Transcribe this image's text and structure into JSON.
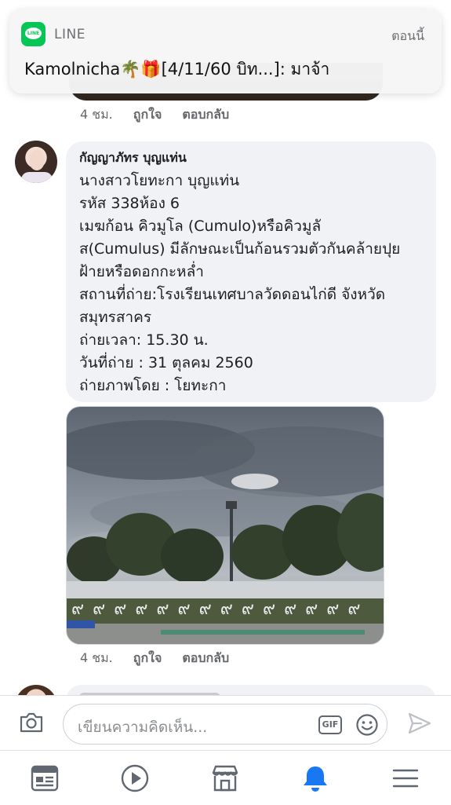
{
  "notification": {
    "app_name": "LINE",
    "icon_label": "LINE",
    "time": "ตอนนี้",
    "message": "Kamolnicha🌴🎁[4/11/60 บิท...]: มาจ้า"
  },
  "previous_comment": {
    "time": "4 ชม.",
    "like": "ถูกใจ",
    "reply": "ตอบกลับ"
  },
  "comment": {
    "author": "กัญญาภัทร บุญแท่น",
    "lines": [
      "นางสาวโยทะกา บุญแท่น",
      "รหัส 338ห้อง 6",
      "เมฆก้อน คิวมูโล (Cumulo)หรือคิวมูลั",
      "ส(Cumulus) มีลักษณะเป็นก้อนรวมตัวกันคล้ายปุย",
      "ฝ้ายหรือดอกกะหล่ำ",
      "สถานที่ถ่าย:โรงเรียนเทศบาลวัดดอนไก่ดี จังหวัด",
      "สมุทรสาคร",
      "ถ่ายเวลา: 15.30 น.",
      "วันที่ถ่าย : 31 ตุลคม 2560",
      "ถ่ายภาพโดย : โยทะกา"
    ],
    "photo_caption_glyphs": "๙ ๙ ๙ ๙ ๙ ๙ ๙ ๙ ๙ ๙ ๙ ๙ ๙ ๙",
    "time": "4 ชม.",
    "like": "ถูกใจ",
    "reply": "ตอบกลับ"
  },
  "composer": {
    "placeholder": "เขียนความคิดเห็น...",
    "gif_label": "GIF"
  },
  "tabbar": {
    "icons": [
      "news-feed-icon",
      "watch-icon",
      "marketplace-icon",
      "notifications-icon",
      "menu-icon"
    ],
    "active": "notifications-icon",
    "active_color": "#1877f2",
    "inactive_color": "#606770"
  },
  "colors": {
    "line_green": "#06c755",
    "bubble_bg": "#f0f2f5",
    "meta_text": "#65676b"
  }
}
